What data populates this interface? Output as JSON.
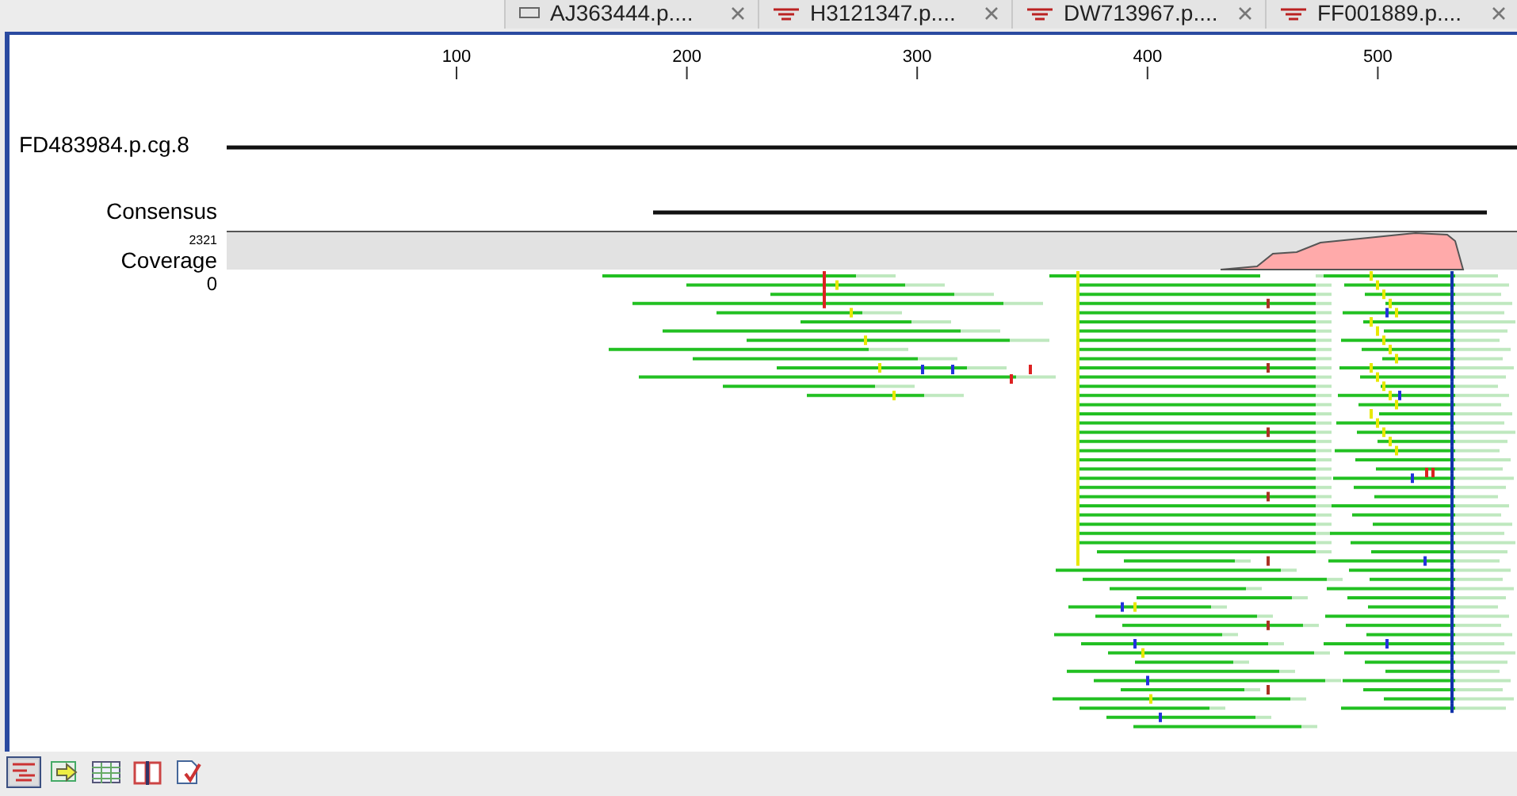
{
  "tabs": [
    {
      "label": "AJ363444.p....",
      "kind": "text",
      "selected": false
    },
    {
      "label": "H3121347.p....",
      "kind": "lines",
      "selected": false
    },
    {
      "label": "DW713967.p....",
      "kind": "lines",
      "selected": false
    },
    {
      "label": "FF001889.p....",
      "kind": "lines",
      "selected": false
    }
  ],
  "ruler": {
    "ticks": [
      "100",
      "200",
      "300",
      "400",
      "500"
    ]
  },
  "reference": {
    "name": "FD483984.p.cg.8"
  },
  "consensus": {
    "label": "Consensus"
  },
  "coverage": {
    "label": "Coverage",
    "max": "2321",
    "min": "0"
  },
  "toolbar": [
    {
      "kind": "reads",
      "selected": true
    },
    {
      "kind": "export",
      "selected": false
    },
    {
      "kind": "table",
      "selected": false
    },
    {
      "kind": "book",
      "selected": false
    },
    {
      "kind": "report",
      "selected": false
    }
  ]
}
